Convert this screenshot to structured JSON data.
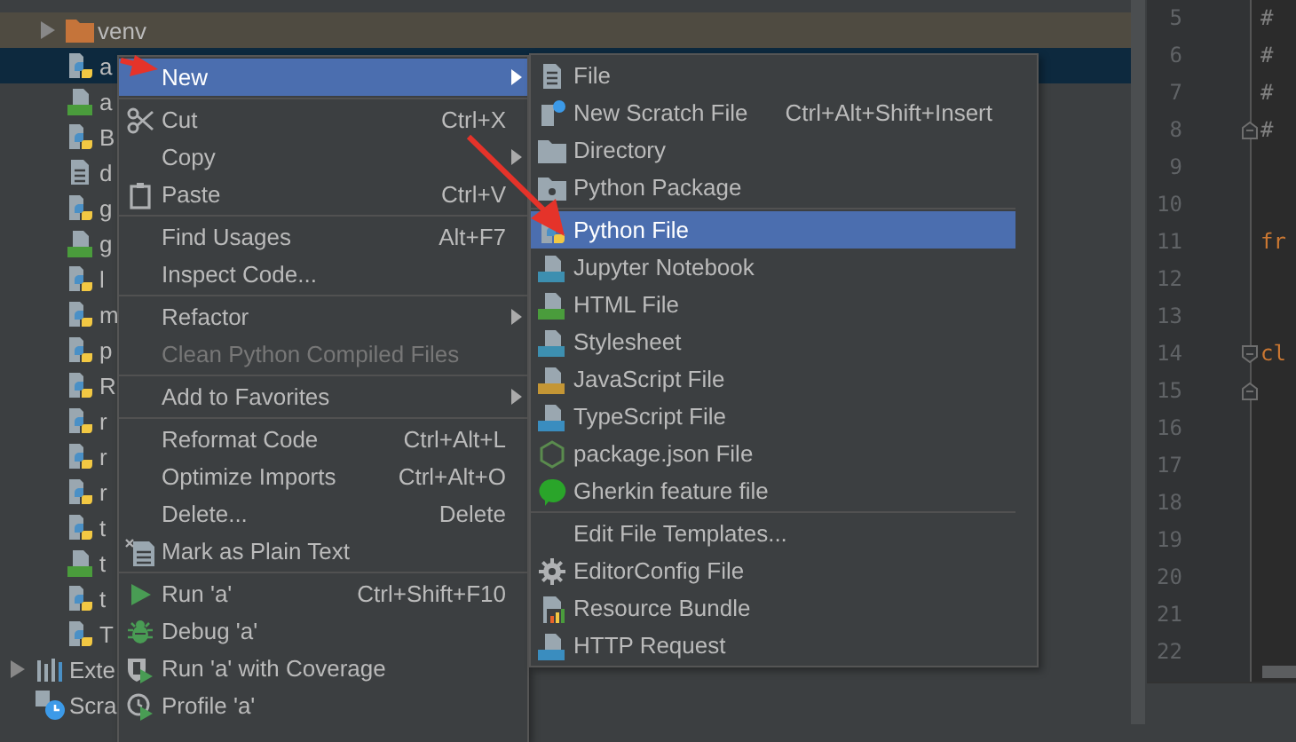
{
  "project_tree": {
    "items": [
      {
        "label": "venv",
        "kind": "folder",
        "expanded": false,
        "selected": false,
        "excluded": true
      },
      {
        "label": "a",
        "kind": "python",
        "selected": true,
        "excluded": false
      },
      {
        "label": "a",
        "kind": "qt",
        "selected": false,
        "excluded": false
      },
      {
        "label": "B",
        "kind": "python",
        "selected": false,
        "excluded": false
      },
      {
        "label": "d",
        "kind": "text",
        "selected": false,
        "excluded": false
      },
      {
        "label": "g",
        "kind": "python",
        "selected": false,
        "excluded": false
      },
      {
        "label": "g",
        "kind": "qt",
        "selected": false,
        "excluded": false
      },
      {
        "label": "l",
        "kind": "python",
        "selected": false,
        "excluded": false
      },
      {
        "label": "m",
        "kind": "python",
        "selected": false,
        "excluded": false
      },
      {
        "label": "p",
        "kind": "python",
        "selected": false,
        "excluded": false
      },
      {
        "label": "R",
        "kind": "python",
        "selected": false,
        "excluded": false
      },
      {
        "label": "r",
        "kind": "python",
        "selected": false,
        "excluded": false
      },
      {
        "label": "r",
        "kind": "python",
        "selected": false,
        "excluded": false
      },
      {
        "label": "r",
        "kind": "python",
        "selected": false,
        "excluded": false
      },
      {
        "label": "t",
        "kind": "python",
        "selected": false,
        "excluded": false
      },
      {
        "label": "t",
        "kind": "qt",
        "selected": false,
        "excluded": false
      },
      {
        "label": "t",
        "kind": "python",
        "selected": false,
        "excluded": false
      },
      {
        "label": "T",
        "kind": "python",
        "selected": false,
        "excluded": false
      }
    ],
    "roots": [
      {
        "label": "Exte",
        "kind": "library",
        "expanded": false,
        "selected": false,
        "excluded": false
      },
      {
        "label": "Scra",
        "kind": "scratch",
        "selected": false,
        "excluded": false
      }
    ]
  },
  "editor": {
    "lines": [
      {
        "number": "5",
        "text": "#",
        "kind": "comment",
        "fold_start": false,
        "fold_end": false
      },
      {
        "number": "6",
        "text": "#",
        "kind": "comment",
        "fold_start": false,
        "fold_end": false
      },
      {
        "number": "7",
        "text": "#",
        "kind": "comment",
        "fold_start": false,
        "fold_end": false
      },
      {
        "number": "8",
        "text": "#",
        "kind": "comment",
        "fold_start": false,
        "fold_end": true
      },
      {
        "number": "9",
        "fold_start": false,
        "fold_end": false
      },
      {
        "number": "10",
        "fold_start": false,
        "fold_end": false
      },
      {
        "number": "11",
        "text": "fr",
        "kind": "keyword",
        "fold_start": false,
        "fold_end": false
      },
      {
        "number": "12",
        "fold_start": false,
        "fold_end": false
      },
      {
        "number": "13",
        "fold_start": false,
        "fold_end": false
      },
      {
        "number": "14",
        "text": "cl",
        "kind": "keyword",
        "fold_start": true,
        "fold_end": false
      },
      {
        "number": "15",
        "fold_start": false,
        "fold_end": true
      },
      {
        "number": "16",
        "fold_start": false,
        "fold_end": false
      },
      {
        "number": "17",
        "fold_start": false,
        "fold_end": false
      },
      {
        "number": "18",
        "fold_start": false,
        "fold_end": false
      },
      {
        "number": "19",
        "fold_start": false,
        "fold_end": false
      },
      {
        "number": "20",
        "fold_start": false,
        "fold_end": false
      },
      {
        "number": "21",
        "fold_start": false,
        "fold_end": false
      },
      {
        "number": "22",
        "fold_start": false,
        "fold_end": false
      }
    ]
  },
  "context_menu": {
    "items": [
      {
        "kind": "item",
        "label": "New",
        "submenu": true,
        "selected": true,
        "disabled": false
      },
      {
        "kind": "separator"
      },
      {
        "kind": "item",
        "label": "Cut",
        "shortcut": "Ctrl+X",
        "submenu": false,
        "selected": false,
        "disabled": false
      },
      {
        "kind": "item",
        "label": "Copy",
        "submenu": true,
        "selected": false,
        "disabled": false
      },
      {
        "kind": "item",
        "label": "Paste",
        "shortcut": "Ctrl+V",
        "submenu": false,
        "selected": false,
        "disabled": false
      },
      {
        "kind": "separator"
      },
      {
        "kind": "item",
        "label": "Find Usages",
        "shortcut": "Alt+F7",
        "submenu": false,
        "selected": false,
        "disabled": false
      },
      {
        "kind": "item",
        "label": "Inspect Code...",
        "submenu": false,
        "selected": false,
        "disabled": false
      },
      {
        "kind": "separator"
      },
      {
        "kind": "item",
        "label": "Refactor",
        "submenu": true,
        "selected": false,
        "disabled": false
      },
      {
        "kind": "item",
        "label": "Clean Python Compiled Files",
        "submenu": false,
        "selected": false,
        "disabled": true
      },
      {
        "kind": "separator"
      },
      {
        "kind": "item",
        "label": "Add to Favorites",
        "submenu": true,
        "selected": false,
        "disabled": false
      },
      {
        "kind": "separator"
      },
      {
        "kind": "item",
        "label": "Reformat Code",
        "shortcut": "Ctrl+Alt+L",
        "submenu": false,
        "selected": false,
        "disabled": false
      },
      {
        "kind": "item",
        "label": "Optimize Imports",
        "shortcut": "Ctrl+Alt+O",
        "submenu": false,
        "selected": false,
        "disabled": false
      },
      {
        "kind": "item",
        "label": "Delete...",
        "shortcut": "Delete",
        "submenu": false,
        "selected": false,
        "disabled": false
      },
      {
        "kind": "item",
        "label": "Mark as Plain Text",
        "submenu": false,
        "selected": false,
        "disabled": false
      },
      {
        "kind": "separator"
      },
      {
        "kind": "item",
        "label": "Run 'a'",
        "shortcut": "Ctrl+Shift+F10",
        "submenu": false,
        "selected": false,
        "disabled": false
      },
      {
        "kind": "item",
        "label": "Debug 'a'",
        "submenu": false,
        "selected": false,
        "disabled": false
      },
      {
        "kind": "item",
        "label": "Run 'a' with Coverage",
        "submenu": false,
        "selected": false,
        "disabled": false
      },
      {
        "kind": "item",
        "label": "Profile 'a'",
        "submenu": false,
        "selected": false,
        "disabled": false
      }
    ]
  },
  "new_submenu": {
    "items": [
      {
        "kind": "item",
        "label": "File",
        "submenu": false,
        "selected": false,
        "disabled": false
      },
      {
        "kind": "item",
        "label": "New Scratch File",
        "shortcut": "Ctrl+Alt+Shift+Insert",
        "submenu": false,
        "selected": false,
        "disabled": false
      },
      {
        "kind": "item",
        "label": "Directory",
        "submenu": false,
        "selected": false,
        "disabled": false
      },
      {
        "kind": "item",
        "label": "Python Package",
        "submenu": false,
        "selected": false,
        "disabled": false
      },
      {
        "kind": "separator"
      },
      {
        "kind": "item",
        "label": "Python File",
        "submenu": false,
        "selected": true,
        "disabled": false
      },
      {
        "kind": "item",
        "label": "Jupyter Notebook",
        "submenu": false,
        "selected": false,
        "disabled": false
      },
      {
        "kind": "item",
        "label": "HTML File",
        "submenu": false,
        "selected": false,
        "disabled": false
      },
      {
        "kind": "item",
        "label": "Stylesheet",
        "submenu": false,
        "selected": false,
        "disabled": false
      },
      {
        "kind": "item",
        "label": "JavaScript File",
        "submenu": false,
        "selected": false,
        "disabled": false
      },
      {
        "kind": "item",
        "label": "TypeScript File",
        "submenu": false,
        "selected": false,
        "disabled": false
      },
      {
        "kind": "item",
        "label": "package.json File",
        "submenu": false,
        "selected": false,
        "disabled": false
      },
      {
        "kind": "item",
        "label": "Gherkin feature file",
        "submenu": false,
        "selected": false,
        "disabled": false
      },
      {
        "kind": "separator"
      },
      {
        "kind": "item",
        "label": "Edit File Templates...",
        "submenu": false,
        "selected": false,
        "disabled": false
      },
      {
        "kind": "item",
        "label": "EditorConfig File",
        "submenu": false,
        "selected": false,
        "disabled": false
      },
      {
        "kind": "item",
        "label": "Resource Bundle",
        "submenu": false,
        "selected": false,
        "disabled": false
      },
      {
        "kind": "item",
        "label": "HTTP Request",
        "submenu": false,
        "selected": false,
        "disabled": false
      }
    ]
  }
}
